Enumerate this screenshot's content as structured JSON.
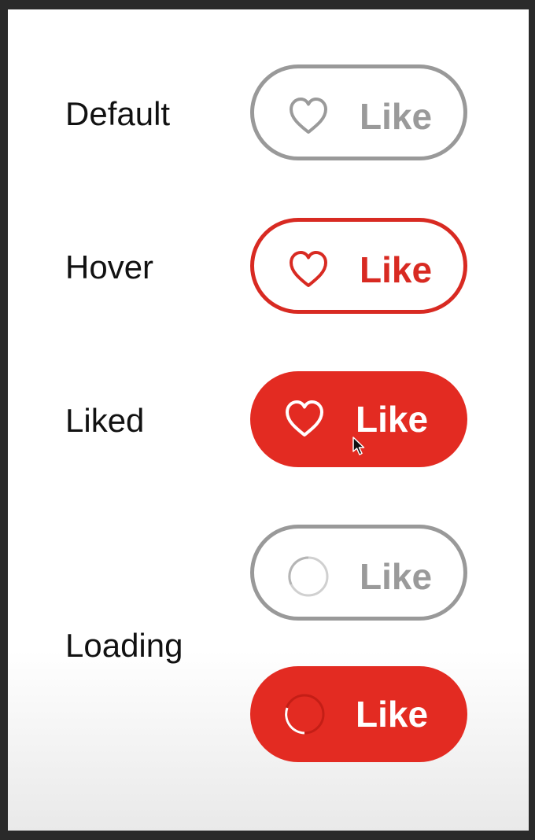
{
  "states": [
    {
      "label": "Default",
      "button_label": "Like",
      "icon": "heart-outline-icon"
    },
    {
      "label": "Hover",
      "button_label": "Like",
      "icon": "heart-outline-icon"
    },
    {
      "label": "Liked",
      "button_label": "Like",
      "icon": "heart-outline-icon"
    },
    {
      "label": "Loading",
      "button_label": "Like",
      "icon": "spinner-icon"
    }
  ],
  "loading_liked": {
    "button_label": "Like",
    "icon": "spinner-icon"
  },
  "colors": {
    "accent_red": "#e32b22",
    "hover_red": "#d82a22",
    "gray_border": "#999999",
    "gray_text": "#9a9a9a"
  }
}
